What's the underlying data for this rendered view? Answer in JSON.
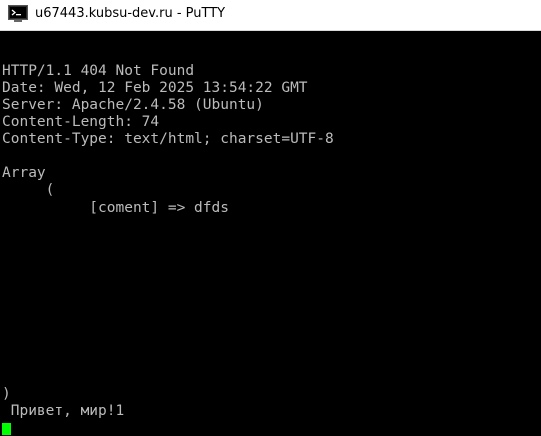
{
  "window": {
    "title": "u67443.kubsu-dev.ru - PuTTY",
    "app_icon": "putty-terminal-icon"
  },
  "terminal": {
    "lines": [
      "HTTP/1.1 404 Not Found",
      "Date: Wed, 12 Feb 2025 13:54:22 GMT",
      "Server: Apache/2.4.58 (Ubuntu)",
      "Content-Length: 74",
      "Content-Type: text/html; charset=UTF-8",
      "Array",
      "     (",
      "          [coment] => dfds",
      ")",
      " Привет, мир!1"
    ],
    "text_color": "#bbbbbb",
    "background": "#000000",
    "cursor_color": "#00ff00"
  }
}
